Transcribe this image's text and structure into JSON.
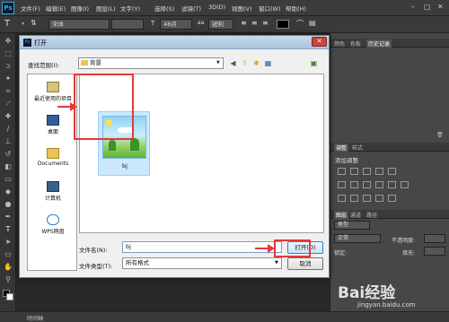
{
  "app": {
    "logo": "Ps"
  },
  "menu": [
    "文件(F)",
    "编辑(E)",
    "图像(I)",
    "图层(L)",
    "文字(Y)",
    "选择(S)",
    "滤镜(T)",
    "3D(D)",
    "视图(V)",
    "窗口(W)",
    "帮助(H)"
  ],
  "options": {
    "font_family": "宋体",
    "font_size": "48点",
    "aa": "锐利"
  },
  "right_dock": {
    "top_tabs": [
      "颜色",
      "色板",
      "历史记录"
    ],
    "mid_tabs": [
      "调整",
      "样式"
    ],
    "adjust_title": "添加调整",
    "layer_tabs": [
      "图层",
      "通道",
      "路径"
    ],
    "kind_label": "类型",
    "blend_mode": "正常",
    "opacity_label": "不透明度:",
    "lock_label": "锁定:",
    "fill_label": "填充:"
  },
  "status": {
    "text": "时间轴"
  },
  "dialog": {
    "title": "打开",
    "lookin_label": "查找范围(I):",
    "lookin_value": "背景",
    "places": [
      "最近使用的项目",
      "桌面",
      "Documents",
      "计算机",
      "WPS网盘"
    ],
    "file_name": "bj",
    "filename_label": "文件名(N):",
    "filename_value": "bj",
    "filetype_label": "文件类型(T):",
    "filetype_value": "所有格式",
    "open_label": "打开(O)",
    "cancel_label": "取消"
  },
  "watermark": {
    "text": "Bai经验",
    "url": "jingyan.baidu.com"
  },
  "colors": {
    "highlight": "#e23a3a",
    "ps_blue": "#35a6e6"
  }
}
